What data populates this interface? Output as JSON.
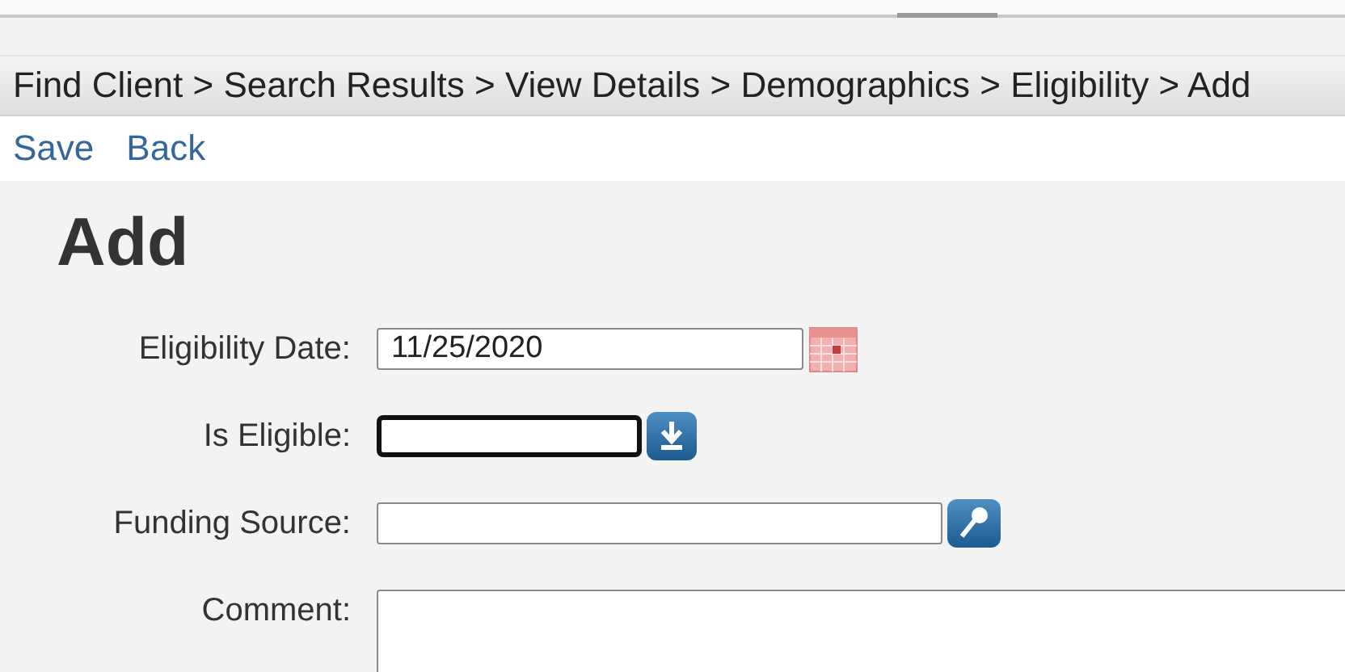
{
  "breadcrumb": [
    "Find Client",
    "Search Results",
    "View Details",
    "Demographics",
    "Eligibility",
    "Add"
  ],
  "breadcrumb_separator": ">",
  "actions": [
    "Save",
    "Back"
  ],
  "heading": "Add",
  "fields": [
    {
      "label": "Eligibility Date:",
      "kind": "date",
      "value": "11/25/2020",
      "focused": false
    },
    {
      "label": "Is Eligible:",
      "kind": "dropdown",
      "focused": true
    },
    {
      "label": "Funding Source:",
      "kind": "lookup",
      "focused": false
    },
    {
      "label": "Comment:",
      "kind": "textarea",
      "focused": false
    }
  ]
}
